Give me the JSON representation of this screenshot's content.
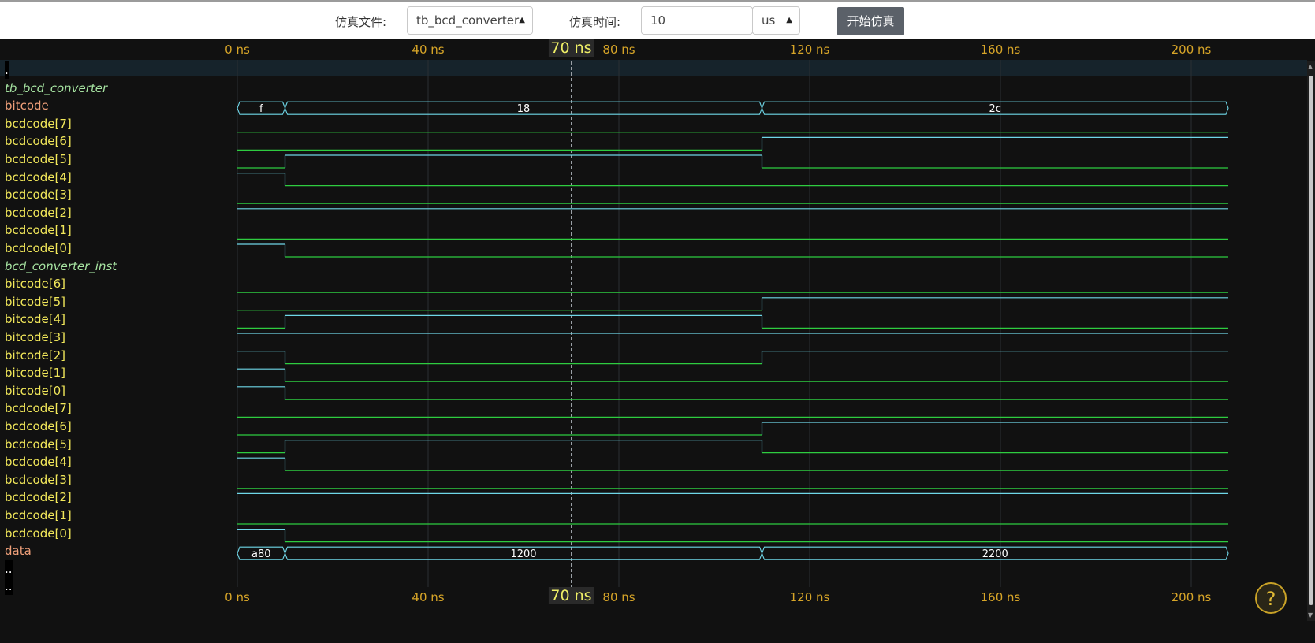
{
  "toolbar": {
    "file_label": "仿真文件:",
    "file_value": "tb_bcd_converter",
    "time_label": "仿真时间:",
    "time_value": "10",
    "unit_value": "us",
    "start_button": "开始仿真"
  },
  "axis": {
    "ticks": [
      "0 ns",
      "40 ns",
      "80 ns",
      "120 ns",
      "160 ns",
      "200 ns"
    ],
    "tick_values_ns": [
      0,
      40,
      80,
      120,
      160,
      200
    ],
    "cursor_label": "70 ns",
    "cursor_ns": 70,
    "color": "#d7a528"
  },
  "colors": {
    "high": "#2ecc40",
    "low": "#2ecc40",
    "bus": "#6fd7e8",
    "grid": "#2a2f33",
    "cursor": "#9aa0a6"
  },
  "signals": [
    {
      "name": ".",
      "kind": "dot"
    },
    {
      "name": "tb_bcd_converter",
      "kind": "group"
    },
    {
      "name": "bitcode",
      "kind": "bus",
      "segments": [
        {
          "t": 0,
          "v": "f"
        },
        {
          "t": 10,
          "v": "18"
        },
        {
          "t": 110,
          "v": "2c"
        }
      ]
    },
    {
      "name": "bcdcode[7]",
      "kind": "bit",
      "trans": [
        [
          0,
          0
        ]
      ]
    },
    {
      "name": "bcdcode[6]",
      "kind": "bit",
      "trans": [
        [
          0,
          0
        ],
        [
          110,
          1
        ]
      ]
    },
    {
      "name": "bcdcode[5]",
      "kind": "bit",
      "trans": [
        [
          0,
          0
        ],
        [
          10,
          1
        ],
        [
          110,
          0
        ]
      ]
    },
    {
      "name": "bcdcode[4]",
      "kind": "bit",
      "trans": [
        [
          0,
          1
        ],
        [
          10,
          0
        ]
      ]
    },
    {
      "name": "bcdcode[3]",
      "kind": "bit",
      "trans": [
        [
          0,
          0
        ]
      ]
    },
    {
      "name": "bcdcode[2]",
      "kind": "bit",
      "trans": [
        [
          0,
          1
        ]
      ]
    },
    {
      "name": "bcdcode[1]",
      "kind": "bit",
      "trans": [
        [
          0,
          0
        ]
      ]
    },
    {
      "name": "bcdcode[0]",
      "kind": "bit",
      "trans": [
        [
          0,
          1
        ],
        [
          10,
          0
        ]
      ]
    },
    {
      "name": "bcd_converter_inst",
      "kind": "group"
    },
    {
      "name": "bitcode[6]",
      "kind": "bit",
      "trans": [
        [
          0,
          0
        ]
      ]
    },
    {
      "name": "bitcode[5]",
      "kind": "bit",
      "trans": [
        [
          0,
          0
        ],
        [
          110,
          1
        ]
      ]
    },
    {
      "name": "bitcode[4]",
      "kind": "bit",
      "trans": [
        [
          0,
          0
        ],
        [
          10,
          1
        ],
        [
          110,
          0
        ]
      ]
    },
    {
      "name": "bitcode[3]",
      "kind": "bit",
      "trans": [
        [
          0,
          1
        ]
      ]
    },
    {
      "name": "bitcode[2]",
      "kind": "bit",
      "trans": [
        [
          0,
          1
        ],
        [
          10,
          0
        ],
        [
          110,
          1
        ]
      ]
    },
    {
      "name": "bitcode[1]",
      "kind": "bit",
      "trans": [
        [
          0,
          1
        ],
        [
          10,
          0
        ]
      ]
    },
    {
      "name": "bitcode[0]",
      "kind": "bit",
      "trans": [
        [
          0,
          1
        ],
        [
          10,
          0
        ]
      ]
    },
    {
      "name": "bcdcode[7]",
      "kind": "bit",
      "trans": [
        [
          0,
          0
        ]
      ]
    },
    {
      "name": "bcdcode[6]",
      "kind": "bit",
      "trans": [
        [
          0,
          0
        ],
        [
          110,
          1
        ]
      ]
    },
    {
      "name": "bcdcode[5]",
      "kind": "bit",
      "trans": [
        [
          0,
          0
        ],
        [
          10,
          1
        ],
        [
          110,
          0
        ]
      ]
    },
    {
      "name": "bcdcode[4]",
      "kind": "bit",
      "trans": [
        [
          0,
          1
        ],
        [
          10,
          0
        ]
      ]
    },
    {
      "name": "bcdcode[3]",
      "kind": "bit",
      "trans": [
        [
          0,
          0
        ]
      ]
    },
    {
      "name": "bcdcode[2]",
      "kind": "bit",
      "trans": [
        [
          0,
          1
        ]
      ]
    },
    {
      "name": "bcdcode[1]",
      "kind": "bit",
      "trans": [
        [
          0,
          0
        ]
      ]
    },
    {
      "name": "bcdcode[0]",
      "kind": "bit",
      "trans": [
        [
          0,
          1
        ],
        [
          10,
          0
        ]
      ]
    },
    {
      "name": "data",
      "kind": "bus",
      "segments": [
        {
          "t": 0,
          "v": "a80"
        },
        {
          "t": 10,
          "v": "1200"
        },
        {
          "t": 110,
          "v": "2200"
        }
      ]
    },
    {
      "name": "..",
      "kind": "dot"
    },
    {
      "name": "..",
      "kind": "dot"
    }
  ],
  "help_icon": "question-mark-icon",
  "help_text": "?"
}
